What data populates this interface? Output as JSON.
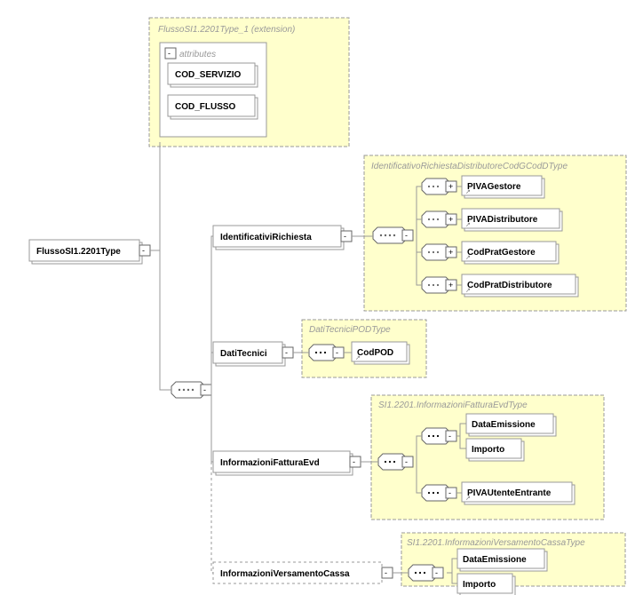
{
  "root": "FlussoSI1.2201Type",
  "ext": {
    "title": "FlussoSI1.2201Type_1 (extension)",
    "attrTitle": "attributes",
    "attrs": [
      "COD_SERVIZIO",
      "COD_FLUSSO"
    ]
  },
  "c1": {
    "node": "IdentificativiRichiesta",
    "group": "IdentificativoRichiestaDistributoreCodGCodDType",
    "leaves": [
      "PIVAGestore",
      "PIVADistributore",
      "CodPratGestore",
      "CodPratDistributore"
    ]
  },
  "c2": {
    "node": "DatiTecnici",
    "group": "DatiTecniciPODType",
    "leaves": [
      "CodPOD"
    ]
  },
  "c3": {
    "node": "InformazioniFatturaEvd",
    "group": "SI1.2201.InformazioniFatturaEvdType",
    "top": [
      "DataEmissione",
      "Importo"
    ],
    "bottom": [
      "PIVAUtenteEntrante"
    ]
  },
  "c4": {
    "node": "InformazioniVersamentoCassa",
    "group": "SI1.2201.InformazioniVersamentoCassaType",
    "leaves": [
      "DataEmissione",
      "Importo"
    ]
  }
}
